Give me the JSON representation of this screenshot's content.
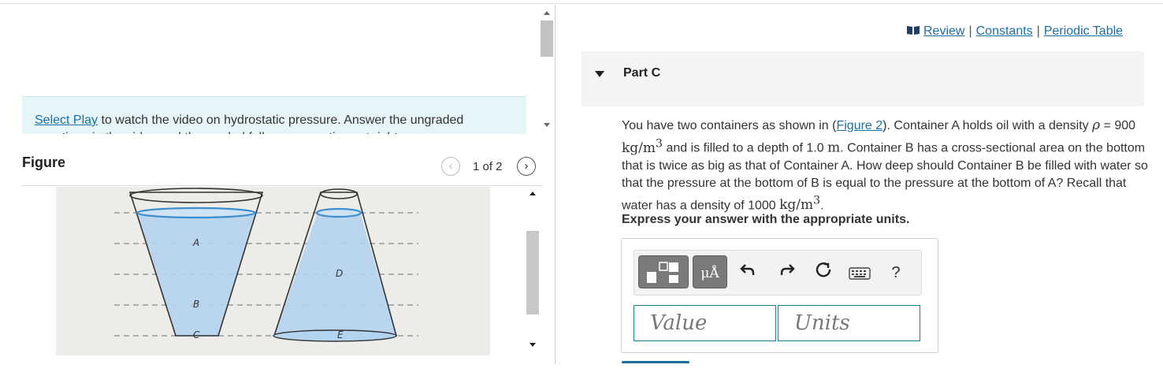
{
  "intro": {
    "link": "Select Play",
    "text": " to watch the video on hydrostatic pressure. Answer the ungraded questions in the video and the graded follow up questions at right."
  },
  "figure": {
    "title": "Figure",
    "pager": "1 of 2",
    "prev_icon": "chevron-left",
    "next_icon": "chevron-right",
    "labels": [
      "A",
      "B",
      "C",
      "D",
      "E"
    ]
  },
  "links": {
    "review": "Review",
    "constants": "Constants",
    "periodic": "Periodic Table",
    "separator": "|"
  },
  "part": {
    "title": "Part C"
  },
  "question": {
    "t1": "You have two containers as shown in (",
    "figure_link": "Figure 2",
    "t2": "). Container A holds oil with a density ",
    "rho": "ρ",
    "t3": " = 900 ",
    "unit_kg": "kg/m",
    "sup3": "3",
    "t4": " and is filled to a depth of 1.0 ",
    "m": "m",
    "t5": ". Container B has a cross-sectional area on the bottom that is twice as big as that of Container A. How deep should Container B be filled with water so that the pressure at the bottom of B is equal to the pressure at the bottom of A? Recall that water has a density of 1000 ",
    "t6": "."
  },
  "instruction": "Express your answer with the appropriate units.",
  "toolbar": {
    "mu_label": "μÅ",
    "help_label": "?",
    "undo_icon": "undo-arrow",
    "redo_icon": "redo-arrow",
    "reset_icon": "reset-circle",
    "keyboard_icon": "keyboard"
  },
  "inputs": {
    "value_placeholder": "Value",
    "units_placeholder": "Units"
  },
  "colors": {
    "link": "#1a6fa0",
    "water": "#b3d4ee",
    "water_line": "#3d8fcf",
    "intro_bg": "#e6f5f7"
  }
}
